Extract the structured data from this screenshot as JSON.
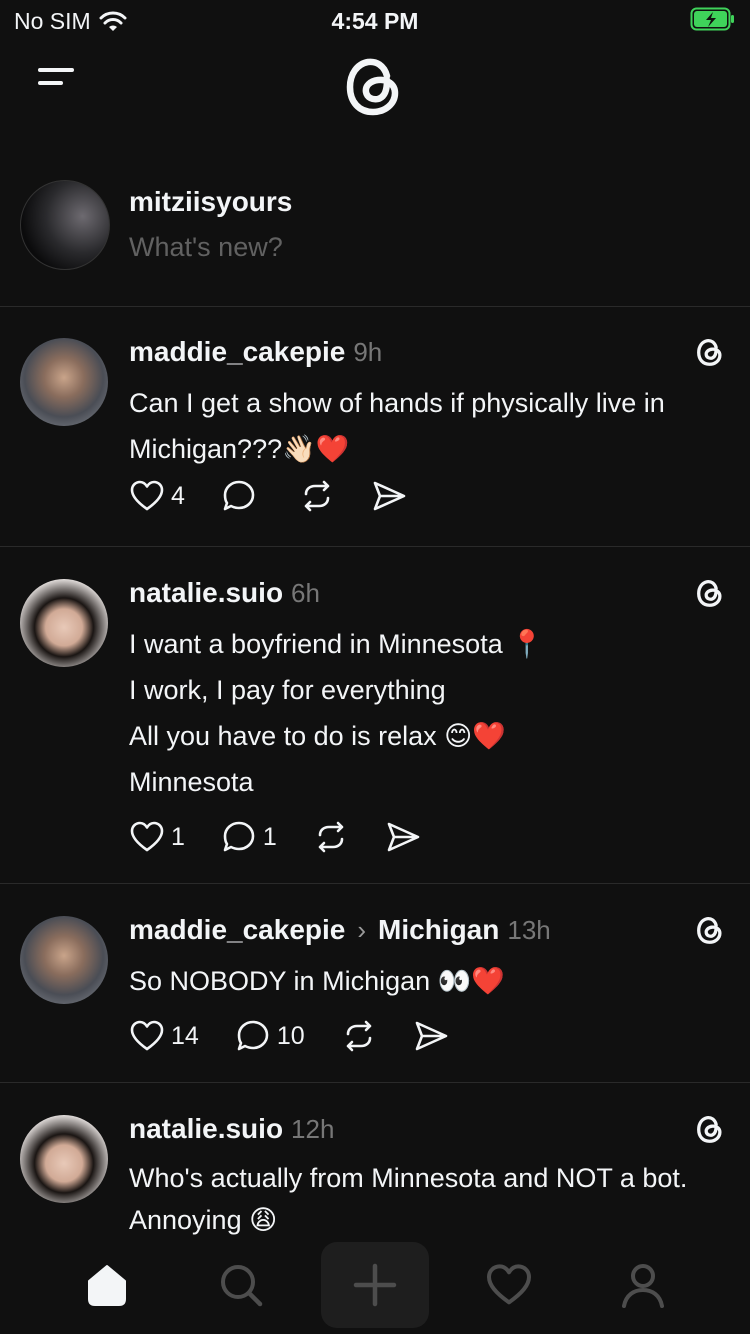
{
  "status": {
    "carrier": "No SIM",
    "time": "4:54 PM"
  },
  "composer": {
    "username": "mitziisyours",
    "placeholder": "What's new?"
  },
  "posts": [
    {
      "username": "maddie_cakepie",
      "topic": "",
      "time": "9h",
      "lines": [
        "Can I get a show of hands if physically live in Michigan???👋🏻❤️"
      ],
      "likes": "4",
      "replies": ""
    },
    {
      "username": "natalie.suio",
      "topic": "",
      "time": "6h",
      "lines": [
        "I want a boyfriend in Minnesota 📍",
        "I work, I pay for everything",
        "All you have to do is relax 😊❤️",
        "Minnesota"
      ],
      "likes": "1",
      "replies": "1"
    },
    {
      "username": "maddie_cakepie",
      "topic": "Michigan",
      "time": "13h",
      "lines": [
        "So NOBODY in Michigan 👀❤️"
      ],
      "likes": "14",
      "replies": "10"
    },
    {
      "username": "natalie.suio",
      "topic": "",
      "time": "12h",
      "lines": [
        "Who's actually from Minnesota and NOT a bot. Annoying 😩"
      ],
      "likes": "",
      "replies": ""
    }
  ],
  "icons": [
    "menu-icon",
    "threads-logo-icon",
    "heart-icon",
    "comment-icon",
    "repost-icon",
    "share-icon",
    "home-icon",
    "search-icon",
    "plus-icon",
    "activity-heart-icon",
    "profile-icon"
  ],
  "colors": {
    "background": "#101010",
    "text": "#f3f5f7",
    "muted": "#777777",
    "divider": "#2a2a2a",
    "battery": "#3fd35a"
  }
}
